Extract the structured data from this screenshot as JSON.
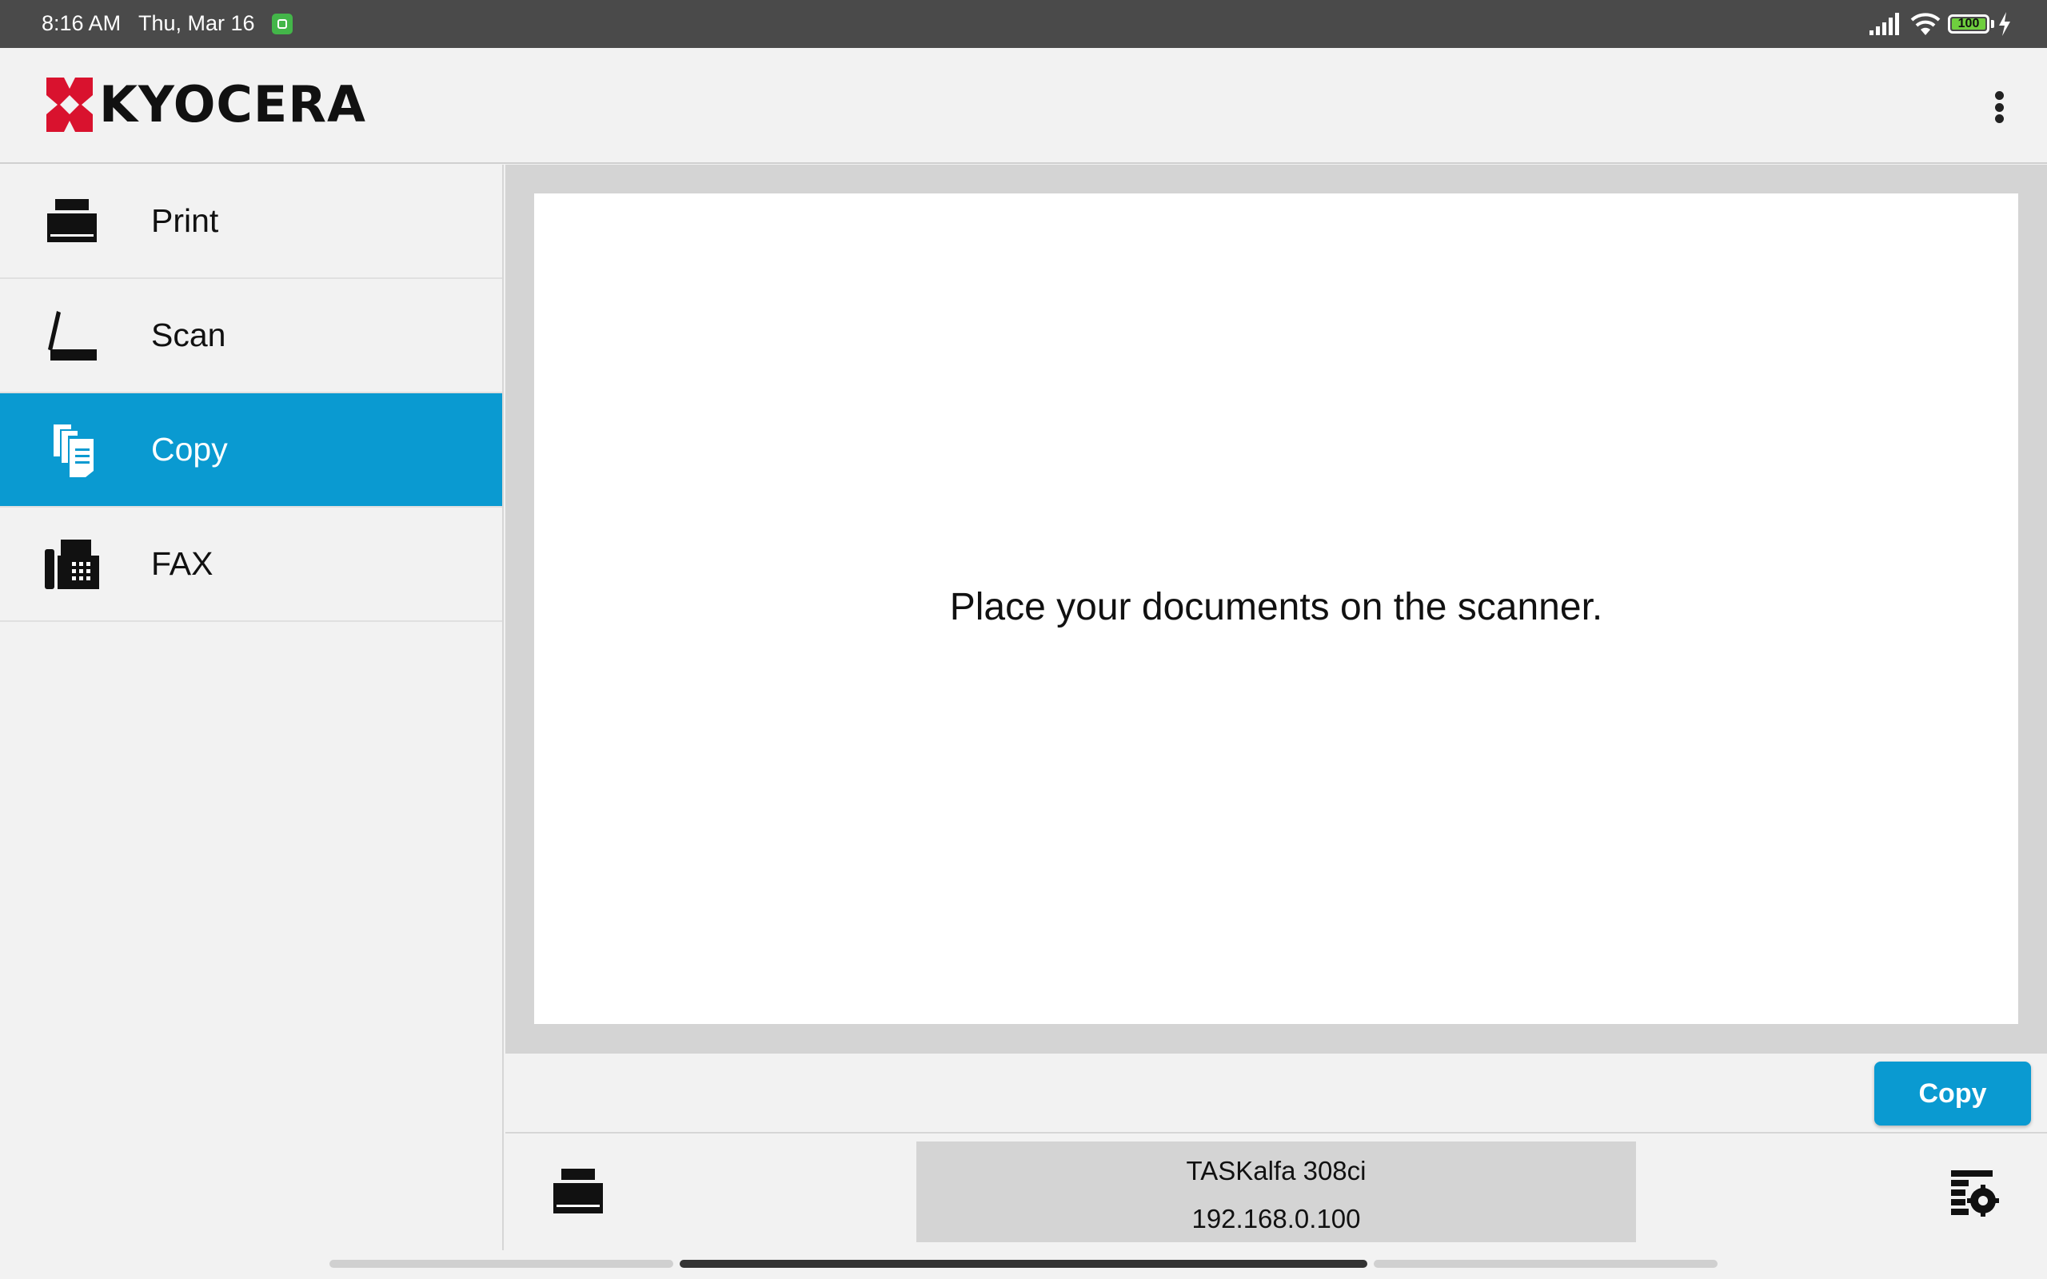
{
  "status_bar": {
    "time": "8:16 AM",
    "date": "Thu, Mar 16",
    "battery": "100"
  },
  "app": {
    "brand": "KYOCERA",
    "brand_color": "#d9122e",
    "accent_color": "#0a9ad1"
  },
  "sidebar": {
    "items": [
      {
        "label": "Print",
        "icon": "printer-icon",
        "active": false
      },
      {
        "label": "Scan",
        "icon": "scanner-icon",
        "active": false
      },
      {
        "label": "Copy",
        "icon": "copy-documents-icon",
        "active": true
      },
      {
        "label": "FAX",
        "icon": "fax-icon",
        "active": false
      }
    ]
  },
  "main": {
    "preview_message": "Place your documents on the scanner.",
    "copy_button": "Copy"
  },
  "device": {
    "name": "TASKalfa 308ci",
    "ip": "192.168.0.100"
  }
}
